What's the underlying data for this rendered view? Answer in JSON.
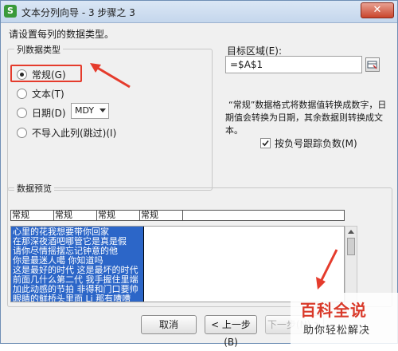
{
  "window": {
    "title": "文本分列向导 - 3 步骤之 3",
    "close_label": "✕"
  },
  "prompt": "请设置每列的数据类型。",
  "column_type_group": {
    "title": "列数据类型",
    "options": [
      {
        "label": "常规(G)",
        "checked": true
      },
      {
        "label": "文本(T)",
        "checked": false
      },
      {
        "label": "日期(D)",
        "checked": false
      },
      {
        "label": "不导入此列(跳过)(I)",
        "checked": false
      }
    ],
    "date_format": "MDY"
  },
  "target": {
    "label": "目标区域(E):",
    "value": "=$A$1"
  },
  "description": [
    "“常规”数据格式将数据值转换成数字，日",
    "期值会转换为日期，其余数据则转换成文",
    "本。"
  ],
  "negative_checkbox": {
    "label": "按负号跟踪负数(M)",
    "checked": true
  },
  "preview": {
    "title": "数据预览",
    "headers": [
      "常规",
      "常规",
      "常规",
      "常规"
    ],
    "lines": [
      "心里的花我想要带你回家",
      "在那深夜酒吧哪管它是真是假",
      "请你尽情摇摆忘记钟意的他",
      "你是最迷人噶 你知道吗",
      "这是最好的时代 这是最坏的时代",
      "前面几什么第二代 我手握住里端",
      "加此动感的节拍 非得和门口要帅",
      "眼睛的鲜桥头里面 Li 那有嘈嘈"
    ]
  },
  "buttons": {
    "cancel": "取消",
    "back": "< 上一步(B)",
    "next": "下一步(N) >"
  },
  "watermark": {
    "brand": "百科全说",
    "slogan": "助你轻松解决"
  },
  "colors": {
    "accent_red": "#e53b2c",
    "selection_blue": "#2c66c8",
    "brand_red": "#d93a2a"
  }
}
